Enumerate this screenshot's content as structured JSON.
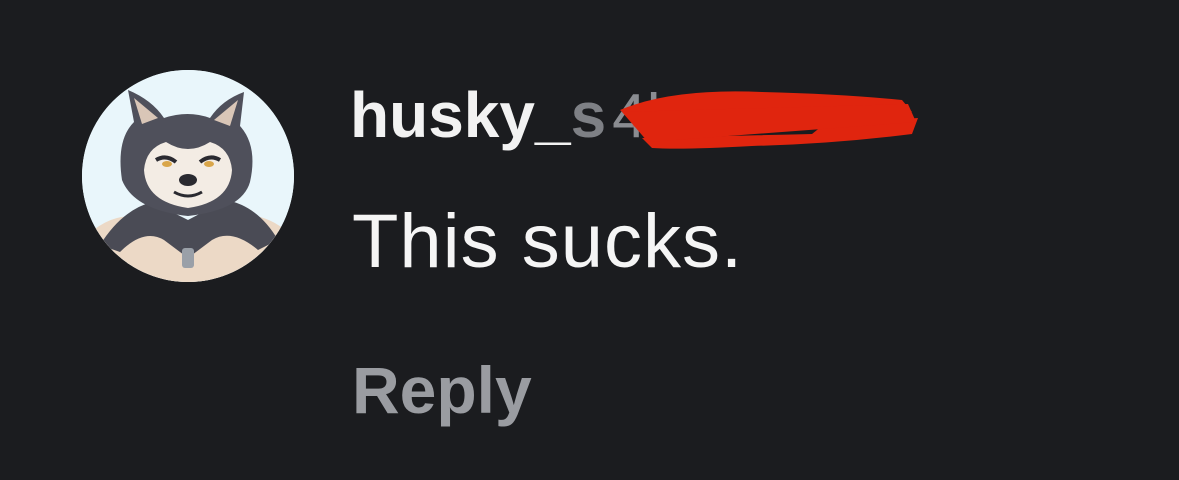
{
  "comment": {
    "username": "husky_",
    "username_hidden_tail": "s",
    "timestamp": "4h",
    "text": "This sucks.",
    "reply_label": "Reply",
    "avatar": "husky-character-avatar"
  },
  "colors": {
    "background": "#1b1c1f",
    "username": "#f2f2f2",
    "meta": "#8a8c91",
    "text": "#f5f5f5",
    "reply": "#9a9ca1",
    "redaction": "#e0250e"
  }
}
